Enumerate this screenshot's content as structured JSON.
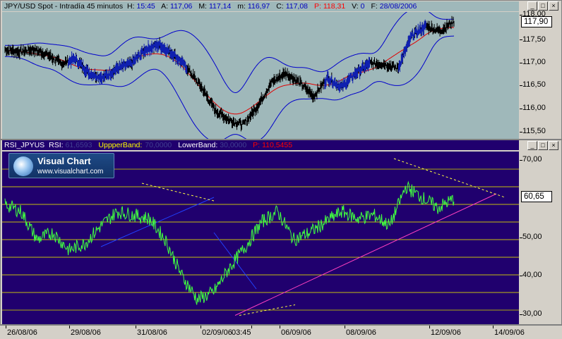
{
  "price_panel": {
    "caption": {
      "instrument": "JPY/USD Spot - Intradía 45 minutos",
      "fields": [
        {
          "label": "H:",
          "value": "15:45"
        },
        {
          "label": "A:",
          "value": "117,06"
        },
        {
          "label": "M:",
          "value": "117,14"
        },
        {
          "label": "m:",
          "value": "116,97"
        },
        {
          "label": "C:",
          "value": "117,08"
        }
      ],
      "p_label": "P:",
      "p_value": "118,31",
      "v_label": "V:",
      "v_value": "0",
      "f_label": "F:",
      "f_value": "28/08/2006"
    },
    "axis_ticks": [
      "118,00",
      "117,50",
      "117,00",
      "116,50",
      "116,00",
      "115,50"
    ],
    "current_value": "117,90"
  },
  "rsi_panel": {
    "caption": {
      "name": "RSI_JPYUS",
      "rsi_label": "RSI:",
      "rsi_value": "61,6593",
      "upper_label": "UppperBand:",
      "upper_value": "70,0000",
      "lower_label": "LowerBand:",
      "lower_value": "30,0000",
      "p_label": "P:",
      "p_value": "110,5455"
    },
    "axis_ticks": [
      "70,00",
      "60,65",
      "50,00",
      "40,00",
      "30,00"
    ],
    "current_value": "60,65"
  },
  "time_axis": {
    "labels": [
      "26/08/06",
      "29/08/06",
      "31/08/06",
      "02/09/06",
      "03:45",
      "06/09/06",
      "08/09/06",
      "12/09/06",
      "14/09/06"
    ]
  },
  "logo": {
    "title": "Visual Chart",
    "url": "www.visualchart.com"
  },
  "window_buttons": [
    "_",
    "□",
    "×"
  ],
  "colors": {
    "price_bg": "#9fb8ba",
    "rsi_bg": "#20006e",
    "bollinger": "#0000cc",
    "moving_average": "#e00000",
    "rsi_line": "#40ff40",
    "trendline": "#ff40c0",
    "level_lines": "#e0e000"
  },
  "chart_data": {
    "type": "line",
    "series": [
      {
        "name": "JPY/USD",
        "values": [
          117.3,
          117.25,
          117.3,
          117.2,
          117.0,
          117.1,
          116.8,
          116.7,
          116.9,
          117.0,
          117.3,
          117.4,
          117.2,
          116.9,
          116.5,
          116.0,
          115.8,
          115.7,
          116.1,
          116.6,
          116.8,
          116.6,
          116.3,
          116.7,
          116.5,
          116.8,
          117.0,
          117.0,
          116.9,
          117.6,
          117.8,
          117.7,
          117.9
        ]
      },
      {
        "name": "RSI",
        "values": [
          60,
          58,
          50,
          52,
          47,
          49,
          54,
          58,
          57,
          56,
          50,
          40,
          33,
          35,
          42,
          48,
          55,
          58,
          50,
          52,
          55,
          58,
          56,
          57,
          54,
          65,
          62,
          59,
          61.6
        ]
      }
    ],
    "ylim_price": [
      115.4,
      118.1
    ],
    "ylim_rsi": [
      26,
      75
    ],
    "rsi_levels": [
      30,
      35,
      40,
      45,
      50,
      55,
      60,
      65,
      70
    ]
  }
}
